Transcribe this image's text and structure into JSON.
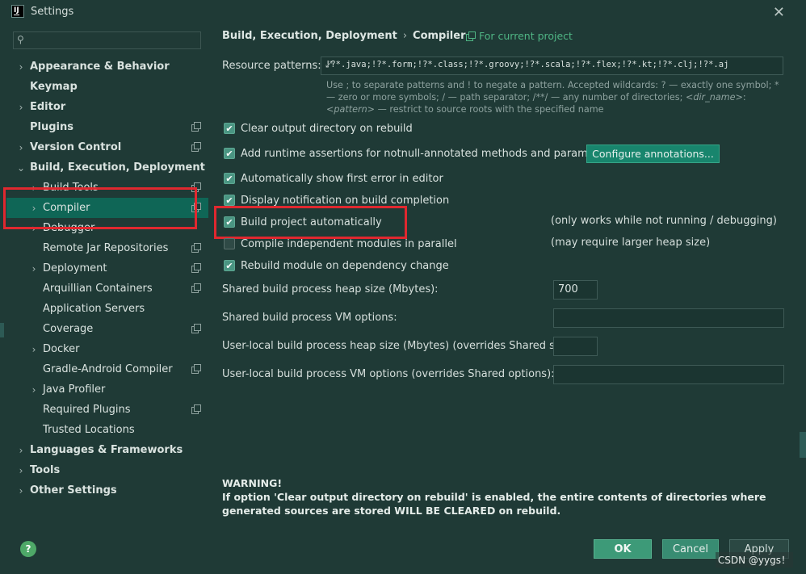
{
  "window": {
    "title": "Settings",
    "app_icon": "intellij-icon"
  },
  "sidebar": {
    "search_placeholder": "",
    "items": [
      {
        "label": "Appearance & Behavior",
        "bold": true,
        "level": 0,
        "arrow": "›",
        "icon": false
      },
      {
        "label": "Keymap",
        "bold": true,
        "level": 0,
        "arrow": "",
        "icon": false
      },
      {
        "label": "Editor",
        "bold": true,
        "level": 0,
        "arrow": "›",
        "icon": false
      },
      {
        "label": "Plugins",
        "bold": true,
        "level": 0,
        "arrow": "",
        "icon": true
      },
      {
        "label": "Version Control",
        "bold": true,
        "level": 0,
        "arrow": "›",
        "icon": true
      },
      {
        "label": "Build, Execution, Deployment",
        "bold": true,
        "level": 0,
        "arrow": "⌄",
        "icon": false
      },
      {
        "label": "Build Tools",
        "bold": false,
        "level": 1,
        "arrow": "›",
        "icon": true
      },
      {
        "label": "Compiler",
        "bold": false,
        "level": 1,
        "arrow": "›",
        "icon": true,
        "selected": true
      },
      {
        "label": "Debugger",
        "bold": false,
        "level": 1,
        "arrow": "›",
        "icon": false
      },
      {
        "label": "Remote Jar Repositories",
        "bold": false,
        "level": 1,
        "arrow": "",
        "icon": true
      },
      {
        "label": "Deployment",
        "bold": false,
        "level": 1,
        "arrow": "›",
        "icon": true
      },
      {
        "label": "Arquillian Containers",
        "bold": false,
        "level": 1,
        "arrow": "",
        "icon": true
      },
      {
        "label": "Application Servers",
        "bold": false,
        "level": 1,
        "arrow": "",
        "icon": false
      },
      {
        "label": "Coverage",
        "bold": false,
        "level": 1,
        "arrow": "",
        "icon": true
      },
      {
        "label": "Docker",
        "bold": false,
        "level": 1,
        "arrow": "›",
        "icon": false
      },
      {
        "label": "Gradle-Android Compiler",
        "bold": false,
        "level": 1,
        "arrow": "",
        "icon": true
      },
      {
        "label": "Java Profiler",
        "bold": false,
        "level": 1,
        "arrow": "›",
        "icon": false
      },
      {
        "label": "Required Plugins",
        "bold": false,
        "level": 1,
        "arrow": "",
        "icon": true
      },
      {
        "label": "Trusted Locations",
        "bold": false,
        "level": 1,
        "arrow": "",
        "icon": false
      },
      {
        "label": "Languages & Frameworks",
        "bold": true,
        "level": 0,
        "arrow": "›",
        "icon": false
      },
      {
        "label": "Tools",
        "bold": true,
        "level": 0,
        "arrow": "›",
        "icon": false
      },
      {
        "label": "Other Settings",
        "bold": true,
        "level": 0,
        "arrow": "›",
        "icon": false
      }
    ]
  },
  "breadcrumb": {
    "parent": "Build, Execution, Deployment",
    "separator": "›",
    "current": "Compiler",
    "scope": "For current project"
  },
  "resource_patterns": {
    "label": "Resource patterns:",
    "value": "!?*.java;!?*.form;!?*.class;!?*.groovy;!?*.scala;!?*.flex;!?*.kt;!?*.clj;!?*.aj",
    "hint_1": "Use ; to separate patterns and ! to negate a pattern. Accepted wildcards: ? — exactly one symbol; * — zero or more symbols; / — path separator; /**/ — any number of directories; ",
    "hint_dir": "<dir_name>",
    "hint_colon": ":",
    "hint_pattern": "<pattern>",
    "hint_2": " — restrict to source roots with the specified name"
  },
  "options": {
    "clear_output": {
      "label": "Clear output directory on rebuild",
      "checked": true
    },
    "runtime_assertions": {
      "label": "Add runtime assertions for notnull-annotated methods and parameters",
      "checked": true
    },
    "configure_button": "Configure annotations...",
    "show_first_error": {
      "label": "Automatically show first error in editor",
      "checked": true
    },
    "display_notification": {
      "label": "Display notification on build completion",
      "checked": true
    },
    "build_automatically": {
      "label": "Build project automatically",
      "checked": true,
      "note": "(only works while not running / debugging)"
    },
    "compile_parallel": {
      "label": "Compile independent modules in parallel",
      "checked": false,
      "note": "(may require larger heap size)"
    },
    "rebuild_module": {
      "label": "Rebuild module on dependency change",
      "checked": true
    }
  },
  "fields": {
    "heap_label": "Shared build process heap size (Mbytes):",
    "heap_value": "700",
    "vm_label": "Shared build process VM options:",
    "vm_value": "",
    "user_heap_label": "User-local build process heap size (Mbytes) (overrides Shared size):",
    "user_heap_value": "",
    "user_vm_label": "User-local build process VM options (overrides Shared options):",
    "user_vm_value": ""
  },
  "warning": {
    "title": "WARNING!",
    "text": "If option 'Clear output directory on rebuild' is enabled, the entire contents of directories where generated sources are stored WILL BE CLEARED on rebuild."
  },
  "footer": {
    "help": "?",
    "ok": "OK",
    "cancel": "Cancel",
    "apply": "Apply",
    "watermark": "CSDN @yygs！"
  },
  "colors": {
    "background": "#1f3a36",
    "selection": "#0f6656",
    "accent_green": "#4fb584",
    "highlight_red": "#e0282f"
  }
}
